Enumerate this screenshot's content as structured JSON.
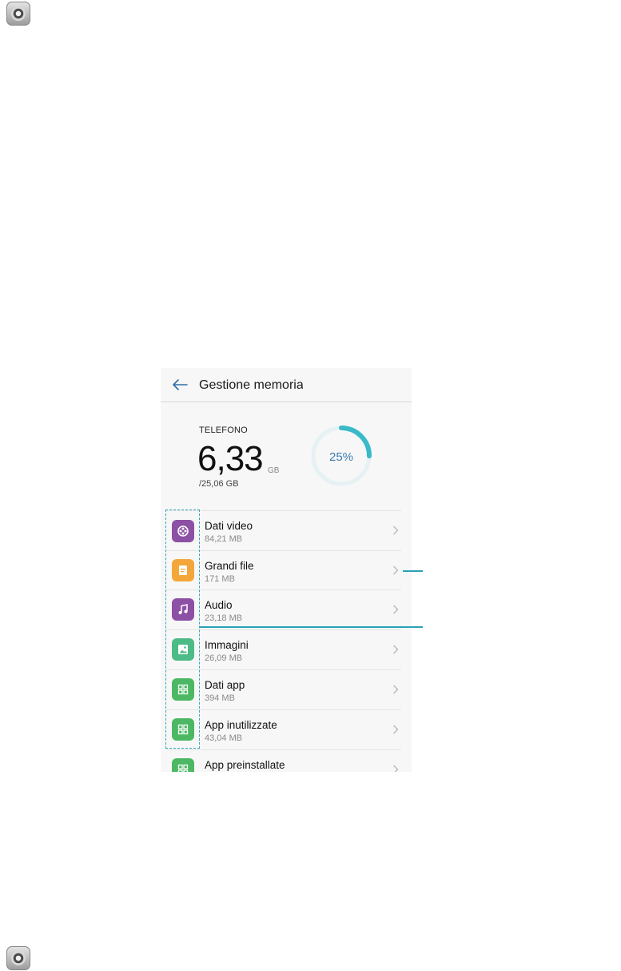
{
  "appbar": {
    "title": "Gestione memoria"
  },
  "storage": {
    "label": "TELEFONO",
    "used": "6,33",
    "unit": "GB",
    "total": "/25,06 GB",
    "percent_label": "25%",
    "percent_value": 0.25
  },
  "items": [
    {
      "title": "Dati video",
      "size": "84,21 MB",
      "icon": "video-icon",
      "color": "#8c51a5"
    },
    {
      "title": "Grandi file",
      "size": "171 MB",
      "icon": "file-icon",
      "color": "#f3a73b"
    },
    {
      "title": "Audio",
      "size": "23,18 MB",
      "icon": "music-note-icon",
      "color": "#8c51a5"
    },
    {
      "title": "Immagini",
      "size": "26,09 MB",
      "icon": "image-icon",
      "color": "#4dbb87"
    },
    {
      "title": "Dati app",
      "size": "394 MB",
      "icon": "apps-grid-icon",
      "color": "#4cb863"
    },
    {
      "title": "App inutilizzate",
      "size": "43,04 MB",
      "icon": "apps-grid-icon",
      "color": "#4cb863"
    },
    {
      "title": "App preinstallate",
      "size": "",
      "icon": "apps-grid-icon",
      "color": "#4cb863"
    }
  ],
  "colors": {
    "accent": "#3ab9c9",
    "ring_track": "#e6f1f4",
    "callout": "#2aa1b5"
  }
}
